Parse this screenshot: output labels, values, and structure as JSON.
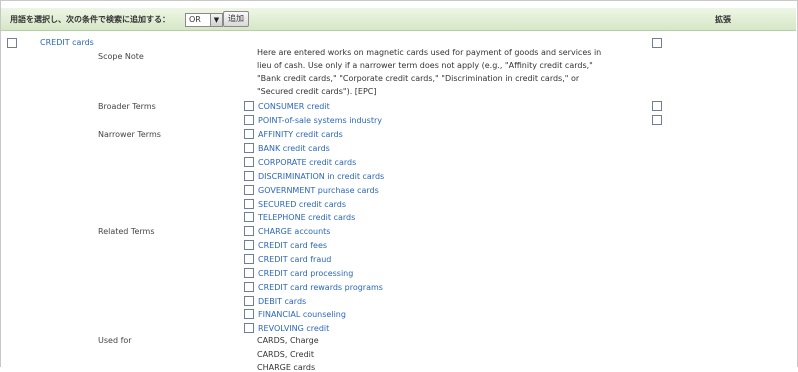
{
  "toolbar": {
    "label": "用語を選択し、次の条件で検索に追加する：",
    "operator": "OR",
    "add_label": "追加",
    "expand_header": "拡張"
  },
  "main_term": "CREDIT cards",
  "fields": {
    "scope_note": "Scope Note",
    "broader": "Broader Terms",
    "narrower": "Narrower Terms",
    "related": "Related Terms",
    "used_for": "Used for"
  },
  "scope_note_text": "Here are entered works on magnetic cards used for payment of goods and services in lieu of cash. Use only if a narrower term does not apply (e.g., \"Affinity credit cards,\" \"Bank credit cards,\" \"Corporate credit cards,\" \"Discrimination in credit cards,\" or \"Secured credit cards\"). [EPC]",
  "broader_terms": [
    "CONSUMER credit",
    "POINT-of-sale systems industry"
  ],
  "narrower_terms": [
    "AFFINITY credit cards",
    "BANK credit cards",
    "CORPORATE credit cards",
    "DISCRIMINATION in credit cards",
    "GOVERNMENT purchase cards",
    "SECURED credit cards",
    "TELEPHONE credit cards"
  ],
  "related_terms": [
    "CHARGE accounts",
    "CREDIT card fees",
    "CREDIT card fraud",
    "CREDIT card processing",
    "CREDIT card rewards programs",
    "DEBIT cards",
    "FINANCIAL counseling",
    "REVOLVING credit"
  ],
  "used_for": [
    "CARDS, Charge",
    "CARDS, Credit",
    "CHARGE cards"
  ]
}
